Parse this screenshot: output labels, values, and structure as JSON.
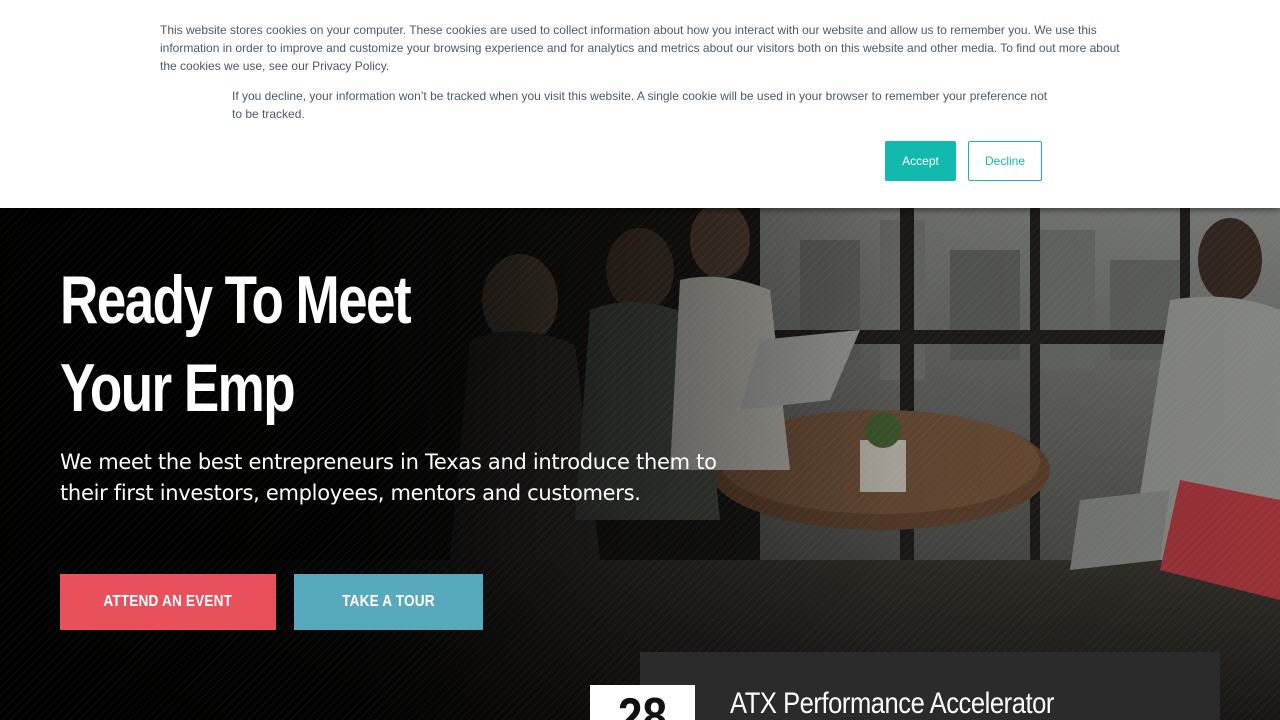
{
  "cookie_banner": {
    "message": "This website stores cookies on your computer. These cookies are used to collect information about how you interact with our website and allow us to remember you. We use this information in order to improve and customize your browsing experience and for analytics and metrics about our visitors both on this website and other media. To find out more about the cookies we use, see our Privacy Policy.",
    "decline_note": "If you decline, your information won’t be tracked when you visit this website. A single cookie will be used in your browser to remember your preference not to be tracked.",
    "accept_label": "Accept",
    "decline_label": "Decline",
    "accent_color": "#14b9ad"
  },
  "hero": {
    "title_line1": "Ready To Meet",
    "title_line2": "Your Emp",
    "subtitle": "We meet the best entrepreneurs in Texas and introduce them to their first investors, employees, mentors and customers.",
    "buttons": [
      {
        "label": "ATTEND AN EVENT",
        "color": "#e8515c"
      },
      {
        "label": "TAKE A TOUR",
        "color": "#58a9be"
      }
    ]
  },
  "event": {
    "day": "28",
    "title": "ATX Performance Accelerator"
  }
}
